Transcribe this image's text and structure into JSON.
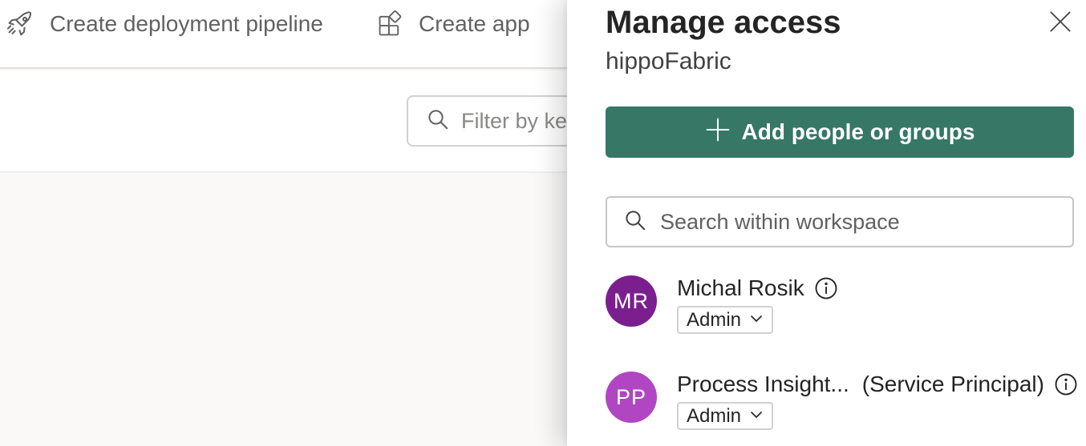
{
  "toolbar": {
    "pipeline_label": "Create deployment pipeline",
    "app_label": "Create app"
  },
  "filter": {
    "placeholder": "Filter by keyword"
  },
  "panel": {
    "title": "Manage access",
    "subtitle": "hippoFabric",
    "add_button_label": "Add people or groups",
    "search_placeholder": "Search within workspace",
    "accent_color": "#367766",
    "members": [
      {
        "initials": "MR",
        "name": "Michal Rosik",
        "suffix": "",
        "role": "Admin",
        "avatar_color": "#7b1f8e"
      },
      {
        "initials": "PP",
        "name": "Process Insight...",
        "suffix": "(Service Principal)",
        "role": "Admin",
        "avatar_color": "#b146c2"
      }
    ]
  },
  "icons": {
    "pipeline": "rocket-icon",
    "app": "app-grid-icon",
    "filter": "search-icon",
    "close": "close-icon",
    "add": "plus-icon",
    "search": "search-icon",
    "info": "info-icon",
    "dropdown": "chevron-down-icon"
  }
}
